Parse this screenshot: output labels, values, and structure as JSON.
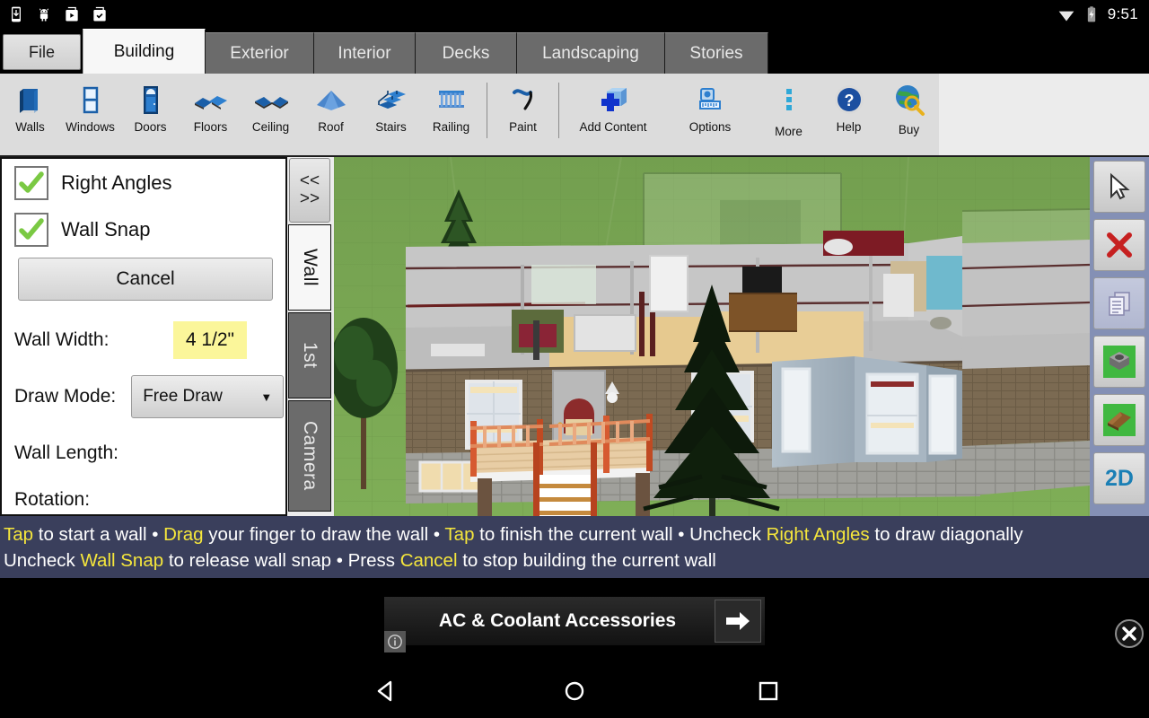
{
  "status_bar": {
    "icons": [
      "download-icon",
      "android-icon",
      "play-store-icon",
      "play-store-check-icon"
    ],
    "wifi_icon": "wifi-icon",
    "battery_icon": "battery-charging-icon",
    "time": "9:51"
  },
  "tabs": [
    {
      "label": "File",
      "active": false,
      "kind": "file"
    },
    {
      "label": "Building",
      "active": true,
      "kind": "normal"
    },
    {
      "label": "Exterior",
      "active": false,
      "kind": "normal"
    },
    {
      "label": "Interior",
      "active": false,
      "kind": "normal"
    },
    {
      "label": "Decks",
      "active": false,
      "kind": "normal"
    },
    {
      "label": "Landscaping",
      "active": false,
      "kind": "normal"
    },
    {
      "label": "Stories",
      "active": false,
      "kind": "normal"
    }
  ],
  "ribbon": {
    "items": [
      {
        "label": "Walls",
        "icon": "walls-icon"
      },
      {
        "label": "Windows",
        "icon": "windows-icon"
      },
      {
        "label": "Doors",
        "icon": "doors-icon"
      },
      {
        "label": "Floors",
        "icon": "floors-icon"
      },
      {
        "label": "Ceiling",
        "icon": "ceiling-icon"
      },
      {
        "label": "Roof",
        "icon": "roof-icon"
      },
      {
        "label": "Stairs",
        "icon": "stairs-icon"
      },
      {
        "label": "Railing",
        "icon": "railing-icon"
      },
      {
        "label": "Paint",
        "icon": "paint-roller-icon"
      },
      {
        "label": "Add Content",
        "icon": "add-content-icon"
      },
      {
        "label": "Options",
        "icon": "tape-measure-icon"
      },
      {
        "label": "More",
        "icon": "more-dots-icon"
      },
      {
        "label": "Help",
        "icon": "help-question-icon"
      },
      {
        "label": "Buy",
        "icon": "globe-key-icon"
      }
    ]
  },
  "panel": {
    "right_angles": {
      "label": "Right Angles",
      "checked": true
    },
    "wall_snap": {
      "label": "Wall Snap",
      "checked": true
    },
    "cancel_label": "Cancel",
    "wall_width": {
      "label": "Wall Width:",
      "value": "4 1/2\"",
      "highlight": "#fbf69a"
    },
    "draw_mode": {
      "label": "Draw Mode:",
      "value": "Free Draw"
    },
    "wall_length": {
      "label": "Wall Length:",
      "value": ""
    },
    "rotation": {
      "label": "Rotation:",
      "value": ""
    }
  },
  "side_tabs": {
    "collapse_label_top": "<<",
    "collapse_label_bottom": ">>",
    "items": [
      {
        "label": "Wall",
        "active": true
      },
      {
        "label": "1st",
        "active": false
      },
      {
        "label": "Camera",
        "active": false
      }
    ]
  },
  "right_tools": [
    {
      "icon": "cursor-select-icon",
      "enabled": true
    },
    {
      "icon": "delete-x-icon",
      "enabled": true
    },
    {
      "icon": "duplicate-pages-icon",
      "enabled": false
    },
    {
      "icon": "object-gray-icon",
      "enabled": true
    },
    {
      "icon": "object-brown-icon",
      "enabled": true
    },
    {
      "icon": "2d-view-icon",
      "label": "2D",
      "enabled": true
    }
  ],
  "hints": {
    "line1": [
      {
        "t": "Tap",
        "hl": true
      },
      {
        "t": " to start a wall • ",
        "hl": false
      },
      {
        "t": "Drag",
        "hl": true
      },
      {
        "t": " your finger to draw the wall • ",
        "hl": false
      },
      {
        "t": "Tap",
        "hl": true
      },
      {
        "t": " to finish the current wall • Uncheck ",
        "hl": false
      },
      {
        "t": "Right Angles",
        "hl": true
      },
      {
        "t": " to draw diagonally",
        "hl": false
      }
    ],
    "line2": [
      {
        "t": "Uncheck ",
        "hl": false
      },
      {
        "t": "Wall Snap",
        "hl": true
      },
      {
        "t": " to release wall snap • Press ",
        "hl": false
      },
      {
        "t": "Cancel",
        "hl": true
      },
      {
        "t": " to stop building the current wall",
        "hl": false
      }
    ]
  },
  "ad": {
    "title": "AC & Coolant Accessories",
    "arrow_icon": "arrow-right-icon",
    "info_icon": "ad-info-icon",
    "close_icon": "ad-close-icon"
  },
  "nav_bar": {
    "back_icon": "nav-back-icon",
    "home_icon": "nav-home-icon",
    "recents_icon": "nav-recents-icon"
  },
  "colors": {
    "hint_bar_bg": "#3a3f5c",
    "hint_keyword": "#f5e63c",
    "highlight_yellow": "#fbf69a",
    "right_tool_bg": "#8490b5",
    "accent_blue": "#1a7fb5"
  }
}
